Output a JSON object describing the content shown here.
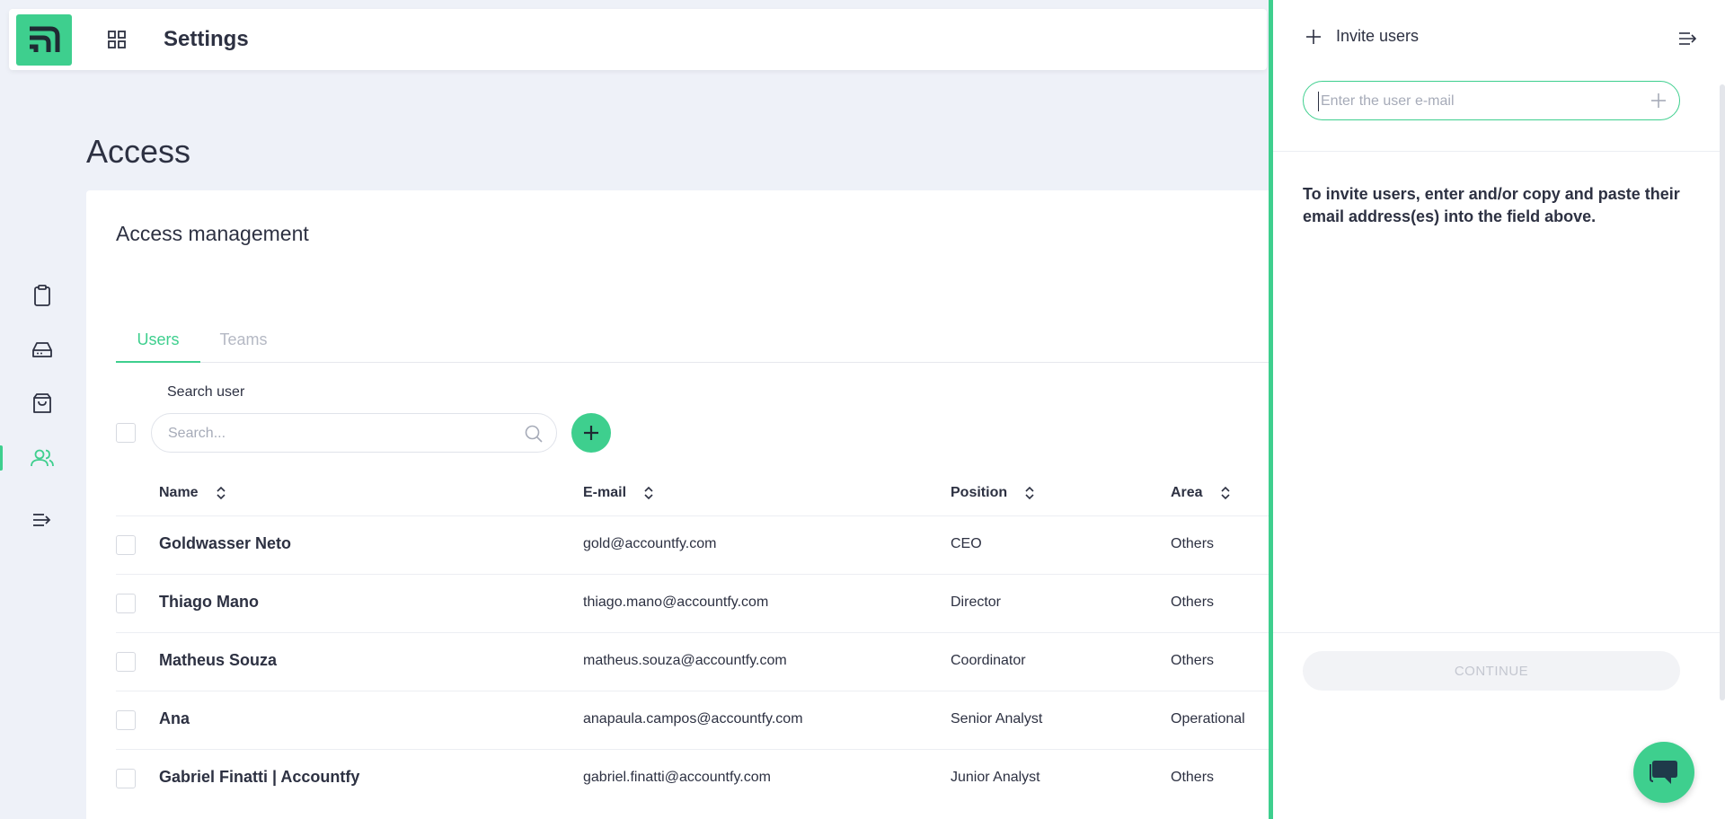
{
  "header": {
    "title": "Settings"
  },
  "page": {
    "title": "Access"
  },
  "card": {
    "title": "Access management"
  },
  "tabs": [
    {
      "label": "Users",
      "active": true
    },
    {
      "label": "Teams",
      "active": false
    }
  ],
  "search": {
    "label": "Search user",
    "placeholder": "Search..."
  },
  "table": {
    "columns": [
      "Name",
      "E-mail",
      "Position",
      "Area"
    ],
    "rows": [
      {
        "name": "Goldwasser Neto",
        "email": "gold@accountfy.com",
        "position": "CEO",
        "area": "Others"
      },
      {
        "name": "Thiago Mano",
        "email": "thiago.mano@accountfy.com",
        "position": "Director",
        "area": "Others"
      },
      {
        "name": "Matheus Souza",
        "email": "matheus.souza@accountfy.com",
        "position": "Coordinator",
        "area": "Others"
      },
      {
        "name": "Ana",
        "email": "anapaula.campos@accountfy.com",
        "position": "Senior Analyst",
        "area": "Operational"
      },
      {
        "name": "Gabriel Finatti | Accountfy",
        "email": "gabriel.finatti@accountfy.com",
        "position": "Junior Analyst",
        "area": "Others"
      }
    ]
  },
  "panel": {
    "title": "Invite users",
    "email_placeholder": "Enter the user e-mail",
    "note": "To invite users, enter and/or copy and paste their email address(es) into the field above.",
    "continue_label": "CONTINUE"
  },
  "colors": {
    "accent": "#3ecf8e",
    "text": "#2d3142",
    "background": "#eef1f8"
  },
  "icons": {
    "rail": [
      "clipboard-icon",
      "drive-icon",
      "shopping-bag-icon",
      "users-icon",
      "menu-expand-icon"
    ]
  }
}
